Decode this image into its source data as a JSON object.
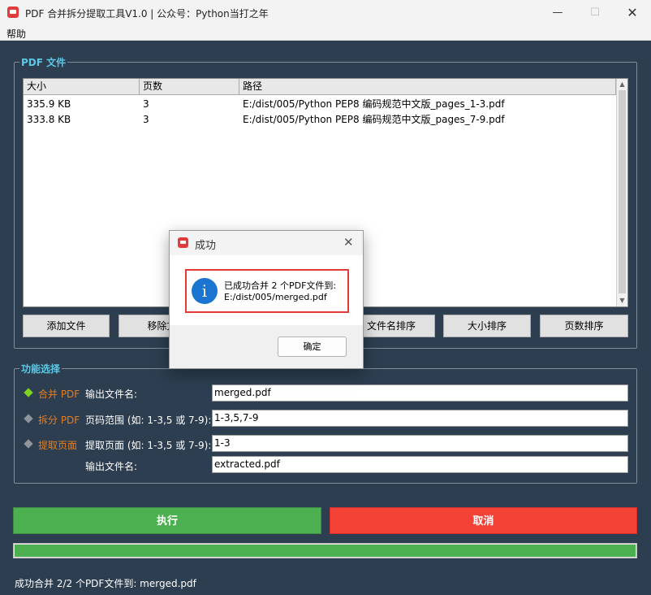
{
  "window": {
    "title": "PDF 合并拆分提取工具V1.0 | 公众号：Python当打之年",
    "minimize": "—",
    "maximize": "☐",
    "close": "✕"
  },
  "menu": {
    "help": "帮助"
  },
  "pdf_group": {
    "title": "PDF 文件",
    "columns": [
      "大小",
      "页数",
      "路径"
    ],
    "rows": [
      {
        "size": "335.9 KB",
        "pages": "3",
        "path": "E:/dist/005/Python PEP8 编码规范中文版_pages_1-3.pdf"
      },
      {
        "size": "333.8 KB",
        "pages": "3",
        "path": "E:/dist/005/Python PEP8 编码规范中文版_pages_7-9.pdf"
      }
    ],
    "buttons": {
      "add": "添加文件",
      "remove": "移除文",
      "sort_name": "文件名排序",
      "sort_size": "大小排序",
      "sort_pages": "页数排序"
    }
  },
  "func_group": {
    "title": "功能选择",
    "merge": {
      "label": "合并 PDF",
      "field_label": "输出文件名:",
      "value": "merged.pdf",
      "selected": true
    },
    "split": {
      "label": "拆分 PDF",
      "field_label": "页码范围 (如: 1-3,5 或 7-9):",
      "value": "1-3,5,7-9",
      "selected": false
    },
    "extract": {
      "label": "提取页面",
      "field_label": "提取页面 (如: 1-3,5 或 7-9):",
      "value": "1-3",
      "field_label2": "输出文件名:",
      "value2": "extracted.pdf",
      "selected": false
    }
  },
  "actions": {
    "execute": "执行",
    "cancel": "取消"
  },
  "progress": {
    "value": 1.0
  },
  "status": "成功合并 2/2 个PDF文件到: merged.pdf",
  "dialog": {
    "title": "成功",
    "info_glyph": "i",
    "message_line1": "已成功合并 2 个PDF文件到:",
    "message_line2": "E:/dist/005/merged.pdf",
    "ok": "确定",
    "close": "✕"
  },
  "colors": {
    "background": "#2c3e50",
    "group_title": "#5dc8e6",
    "mode_orange": "#e67e22",
    "selected_marker": "#7ed321",
    "execute": "#4caf50",
    "cancel": "#f44336",
    "highlight": "#e53935"
  }
}
